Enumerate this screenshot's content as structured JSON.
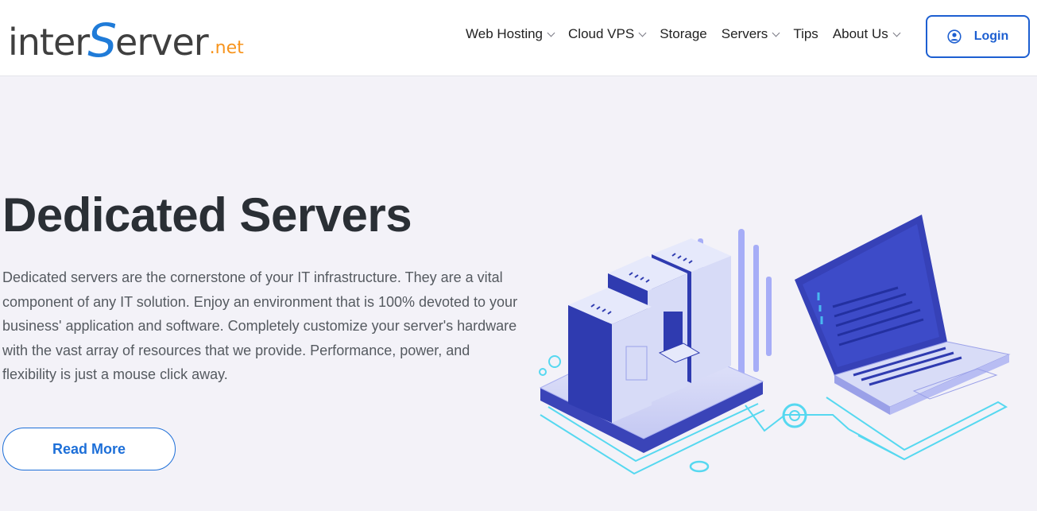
{
  "header": {
    "logo": {
      "part1": "inter",
      "part2": "S",
      "part3": "erver",
      "part4": ".net"
    },
    "nav": [
      {
        "label": "Web Hosting",
        "has_dropdown": true
      },
      {
        "label": "Cloud VPS",
        "has_dropdown": true
      },
      {
        "label": "Storage",
        "has_dropdown": false
      },
      {
        "label": "Servers",
        "has_dropdown": true
      },
      {
        "label": "Tips",
        "has_dropdown": false
      },
      {
        "label": "About Us",
        "has_dropdown": true
      }
    ],
    "login_label": "Login",
    "login_icon": "user-circle-icon"
  },
  "hero": {
    "title": "Dedicated Servers",
    "description": "Dedicated servers are the cornerstone of your IT infrastructure. They are a vital component of any IT solution. Enjoy an environment that is 100% devoted to your business' application and software. Completely customize your server's hardware with the vast array of resources that we provide. Performance, power, and flexibility is just a mouse click away.",
    "cta_label": "Read More",
    "illustration_icon": "server-rack-laptop-illustration"
  },
  "colors": {
    "brand_blue": "#1d5fd1",
    "logo_orange": "#f7941d",
    "background": "#f3f2f8",
    "title": "#2a2f35"
  }
}
